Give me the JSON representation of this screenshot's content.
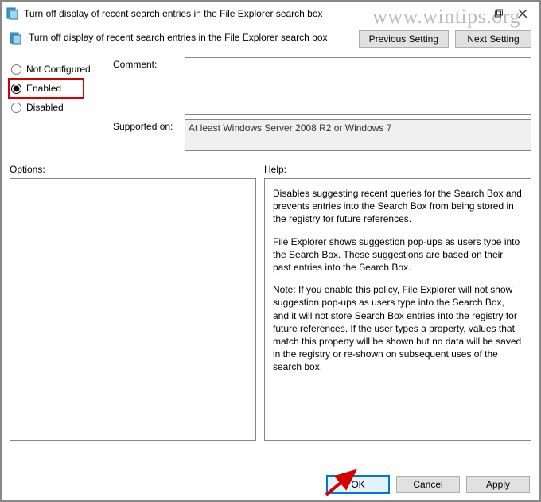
{
  "watermark": "www.wintips.org",
  "titlebar": {
    "title": "Turn off display of recent search entries in the File Explorer search box"
  },
  "subheader": {
    "title": "Turn off display of recent search entries in the File Explorer search box",
    "prev_btn": "Previous Setting",
    "next_btn": "Next Setting"
  },
  "radios": {
    "not_configured": "Not Configured",
    "enabled": "Enabled",
    "disabled": "Disabled",
    "selected": "enabled"
  },
  "fields": {
    "comment_label": "Comment:",
    "comment_value": "",
    "supported_label": "Supported on:",
    "supported_value": "At least Windows Server 2008 R2 or Windows 7"
  },
  "panels": {
    "options_label": "Options:",
    "help_label": "Help:",
    "help_p1": "Disables suggesting recent queries for the Search Box and prevents entries into the Search Box from being stored in the registry for future references.",
    "help_p2": "File Explorer shows suggestion pop-ups as users type into the Search Box.  These suggestions are based on their past entries into the Search Box.",
    "help_p3": "Note: If you enable this policy, File Explorer will not show suggestion pop-ups as users type into the Search Box, and it will not store Search Box entries into the registry for future references.  If the user types a property, values that match this property will be shown but no data will be saved in the registry or re-shown on subsequent uses of the search box."
  },
  "buttons": {
    "ok": "OK",
    "cancel": "Cancel",
    "apply": "Apply"
  }
}
